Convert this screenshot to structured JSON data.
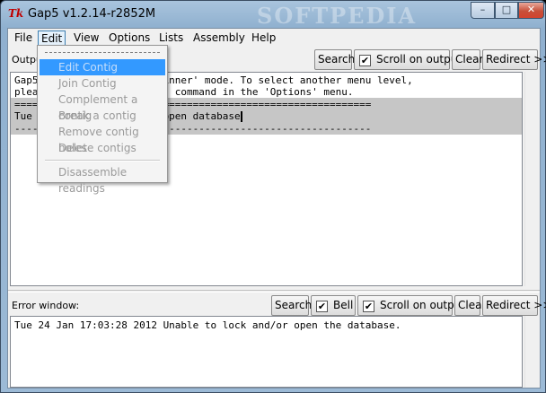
{
  "window": {
    "title": "Gap5 v1.2.14-r2852M",
    "app_icon": "Tk",
    "watermark": "SOFTPEDIA",
    "controls": {
      "minimize": "–",
      "maximize": "□",
      "close": "✕"
    }
  },
  "menubar": [
    "File",
    "Edit",
    "View",
    "Options",
    "Lists",
    "Assembly",
    "Help"
  ],
  "output_toolbar": {
    "label": "Output:",
    "search_label": "Search",
    "scroll_label": "Scroll on output",
    "scroll_checked": true,
    "clear_label": "Clear",
    "redirect_label": "Redirect >>"
  },
  "output_lines": [
    "Gap5 is currently in 'beginner' mode. To select another menu level,",
    "please use the 'Set menus' command in the 'Options' menu.",
    "============================================================",
    "Tue 24 Jan 17:03:28 2012 open database",
    "------------------------------------------------------------"
  ],
  "edit_menu": {
    "items": [
      "Edit Contig",
      "Join Contig",
      "Complement a contig",
      "Break a contig",
      "Remove contig holes",
      "Delete contigs"
    ],
    "extra_item": "Disassemble readings"
  },
  "error_toolbar": {
    "label": "Error window:",
    "search_label": "Search",
    "bell_label": "Bell",
    "bell_checked": true,
    "scroll_label": "Scroll on output",
    "scroll_checked": true,
    "clear_label": "Clear",
    "redirect_label": "Redirect >>"
  },
  "error_lines": [
    "Tue 24 Jan 17:03:28 2012 Unable to lock and/or open the database."
  ],
  "checkmark": "✔"
}
